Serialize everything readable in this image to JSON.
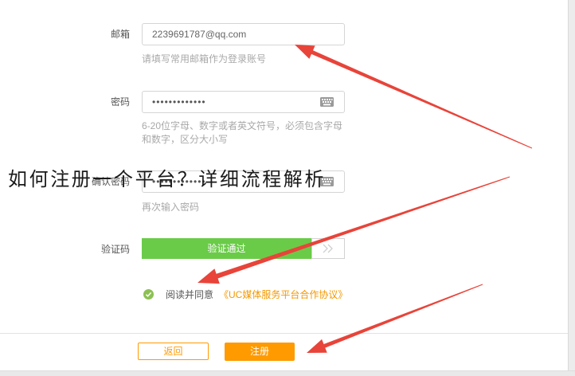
{
  "overlay_title": "如何注册一个平台？详细流程解析",
  "form": {
    "email": {
      "label": "邮箱",
      "value": "2239691787@qq.com",
      "hint": "请填写常用邮箱作为登录账号"
    },
    "password": {
      "label": "密码",
      "value": "•••••••••••••",
      "hint_lines": [
        "6-20位字母、数字或者英文符号，必须包含字母",
        "和数字，区分大小写"
      ],
      "icon": "keyboard-icon"
    },
    "confirm_password": {
      "label": "确认密码",
      "value": "•••••••••••••",
      "hint": "再次输入密码",
      "icon": "keyboard-icon"
    },
    "captcha": {
      "label": "验证码",
      "status_text": "验证通过",
      "handle_icon": "double-chevron-right-icon"
    },
    "agreement": {
      "checked": true,
      "check_icon": "check-circle-icon",
      "prefix": "阅读并同意",
      "link_text": "《UC媒体服务平台合作协议》"
    }
  },
  "buttons": {
    "back_label": "返回",
    "register_label": "注册"
  },
  "colors": {
    "accent": "#ff9a00",
    "link": "#f39800",
    "success": "#6acb48",
    "check": "#8cc152",
    "annotation_arrow": "#e8443a"
  }
}
